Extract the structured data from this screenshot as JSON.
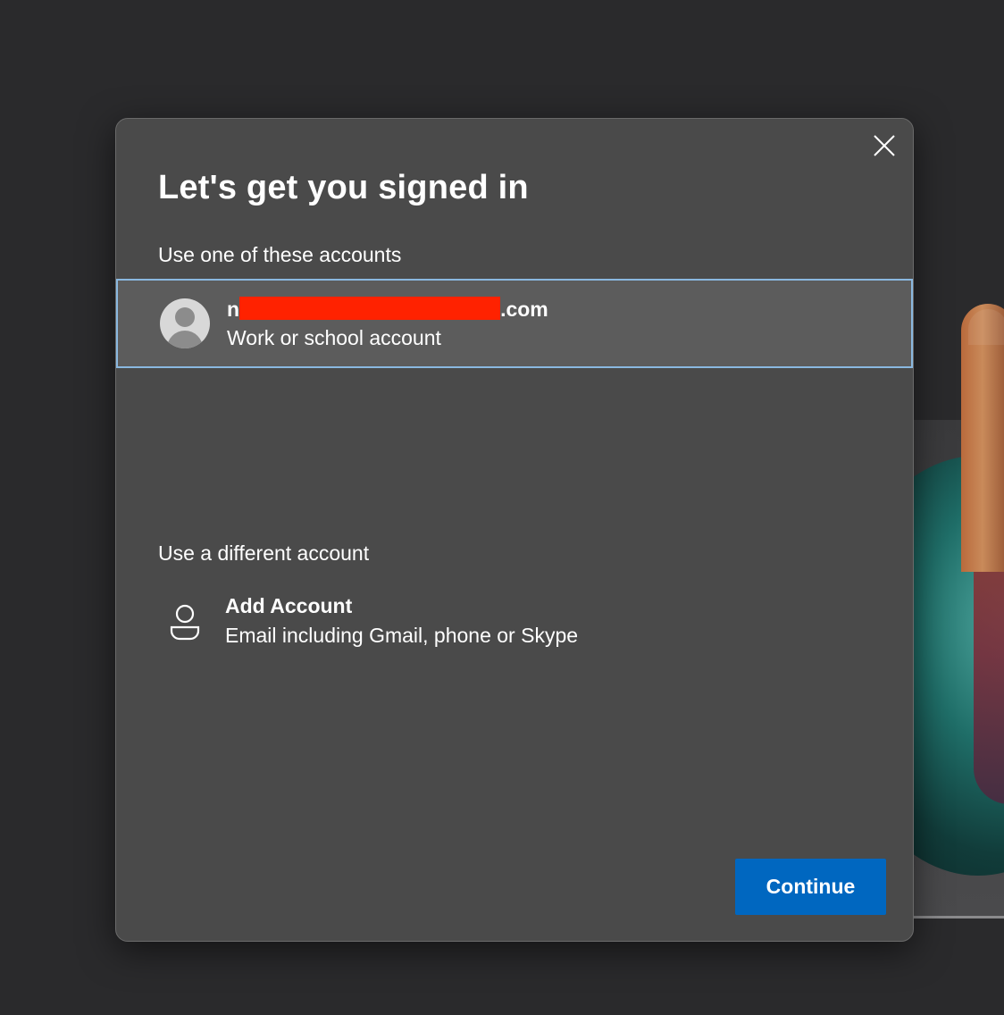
{
  "dialog": {
    "title": "Let's get you signed in",
    "close_icon": "close-icon"
  },
  "accounts_section": {
    "label": "Use one of these accounts",
    "accounts": [
      {
        "email_prefix": "n",
        "email_suffix": ".com",
        "type": "Work or school account",
        "avatar_icon": "person-avatar-icon",
        "redacted": true
      }
    ]
  },
  "different_section": {
    "label": "Use a different account",
    "add_account": {
      "title": "Add Account",
      "subtitle": "Email including Gmail, phone or Skype",
      "icon": "person-outline-icon"
    }
  },
  "actions": {
    "continue_label": "Continue"
  },
  "colors": {
    "dialog_bg": "#4a4a4a",
    "selected_row_bg": "#5c5c5c",
    "selected_row_border": "#8ab8e0",
    "primary_button": "#0067c0",
    "redaction": "#ff2200"
  }
}
